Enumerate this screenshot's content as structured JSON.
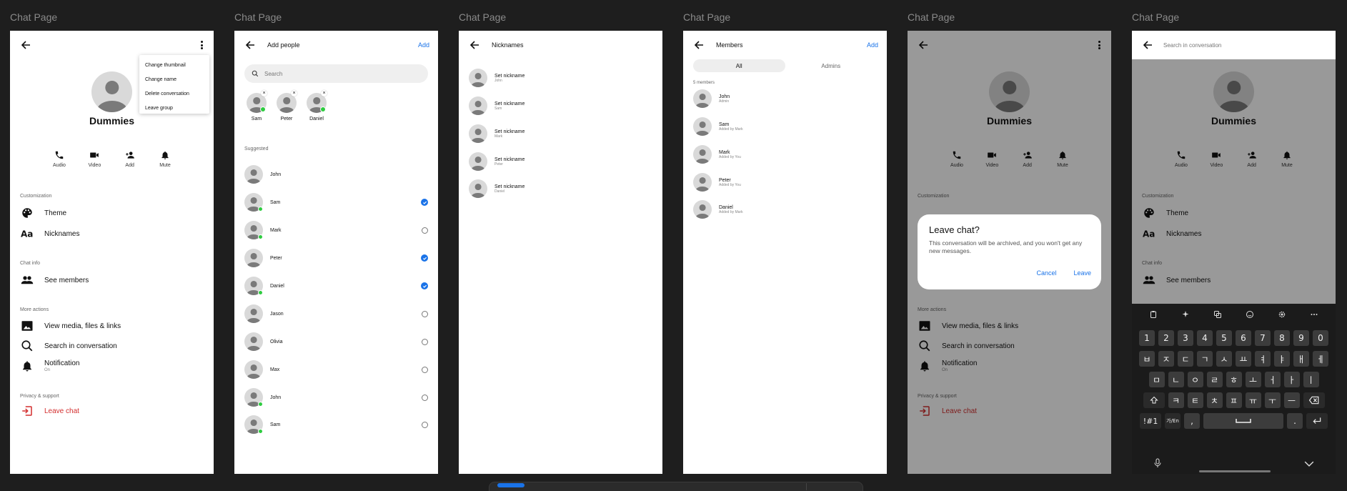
{
  "frames": [
    {
      "frame_title": "Chat Page",
      "group_name": "Dummies",
      "menu": [
        "Change thumbnail",
        "Change name",
        "Delete conversation",
        "Leave group"
      ],
      "actions": [
        "Audio",
        "Video",
        "Add",
        "Mute"
      ],
      "customization_label": "Customization",
      "theme": "Theme",
      "nicknames": "Nicknames",
      "chat_info_label": "Chat info",
      "see_members": "See members",
      "more_actions_label": "More actions",
      "view_media": "View media, files & links",
      "search_conversation": "Search in conversation",
      "notification": "Notification",
      "notification_sub": "On",
      "privacy_label": "Privacy & support",
      "leave_chat": "Leave chat"
    },
    {
      "frame_title": "Chat Page",
      "title": "Add people",
      "add": "Add",
      "search_placeholder": "Search",
      "selected": [
        {
          "name": "Sam",
          "online": true
        },
        {
          "name": "Peter",
          "online": false
        },
        {
          "name": "Daniel",
          "online": true
        }
      ],
      "x_symbol": "×",
      "suggested_label": "Suggested",
      "suggested": [
        {
          "name": "John",
          "online": false,
          "state": "none"
        },
        {
          "name": "Sam",
          "online": true,
          "state": "checked"
        },
        {
          "name": "Mark",
          "online": true,
          "state": "radio"
        },
        {
          "name": "Peter",
          "online": false,
          "state": "checked"
        },
        {
          "name": "Daniel",
          "online": true,
          "state": "checked"
        },
        {
          "name": "Jason",
          "online": false,
          "state": "radio"
        },
        {
          "name": "Olivia",
          "online": false,
          "state": "radio"
        },
        {
          "name": "Max",
          "online": false,
          "state": "radio"
        },
        {
          "name": "John",
          "online": true,
          "state": "radio"
        },
        {
          "name": "Sam",
          "online": true,
          "state": "radio"
        }
      ]
    },
    {
      "frame_title": "Chat Page",
      "title": "Nicknames",
      "items": [
        {
          "label": "Set nickname",
          "sub": "John"
        },
        {
          "label": "Set nickname",
          "sub": "Sam"
        },
        {
          "label": "Set nickname",
          "sub": "Mark"
        },
        {
          "label": "Set nickname",
          "sub": "Peter"
        },
        {
          "label": "Set nickname",
          "sub": "Daniel"
        }
      ]
    },
    {
      "frame_title": "Chat Page",
      "title": "Members",
      "add": "Add",
      "tabs": [
        "All",
        "Admins"
      ],
      "count_label": "5 members",
      "members": [
        {
          "name": "John",
          "sub": "Admin"
        },
        {
          "name": "Sam",
          "sub": "Added by Mark"
        },
        {
          "name": "Mark",
          "sub": "Added by You"
        },
        {
          "name": "Peter",
          "sub": "Added by You"
        },
        {
          "name": "Daniel",
          "sub": "Added by Mark"
        }
      ]
    },
    {
      "frame_title": "Chat Page",
      "group_name": "Dummies",
      "actions": [
        "Audio",
        "Video",
        "Add",
        "Mute"
      ],
      "customization_label": "Customization",
      "more_actions_label": "More actions",
      "view_media": "View media, files & links",
      "search_conversation": "Search in conversation",
      "notification": "Notification",
      "notification_sub": "On",
      "privacy_label": "Privacy & support",
      "leave_chat": "Leave chat",
      "dialog": {
        "title": "Leave chat?",
        "body": "This conversation will be archived, and you won't get any new messages.",
        "cancel": "Cancel",
        "leave": "Leave"
      }
    },
    {
      "frame_title": "Chat Page",
      "search_placeholder": "Search in conversation",
      "group_name": "Dummies",
      "actions": [
        "Audio",
        "Video",
        "Add",
        "Mute"
      ],
      "customization_label": "Customization",
      "theme": "Theme",
      "nicknames": "Nicknames",
      "chat_info_label": "Chat info",
      "see_members": "See members",
      "keyboard": {
        "row1": [
          "1",
          "2",
          "3",
          "4",
          "5",
          "6",
          "7",
          "8",
          "9",
          "0"
        ],
        "row2": [
          "ㅂ",
          "ㅈ",
          "ㄷ",
          "ㄱ",
          "ㅅ",
          "ㅛ",
          "ㅕ",
          "ㅑ",
          "ㅐ",
          "ㅔ"
        ],
        "row3": [
          "ㅁ",
          "ㄴ",
          "ㅇ",
          "ㄹ",
          "ㅎ",
          "ㅗ",
          "ㅓ",
          "ㅏ",
          "ㅣ"
        ],
        "row4": [
          "ㅋ",
          "ㅌ",
          "ㅊ",
          "ㅍ",
          "ㅠ",
          "ㅜ",
          "ㅡ"
        ],
        "symbols_key": "!#1",
        "lang_key": "가/En",
        "comma": ",",
        "period": "."
      }
    }
  ],
  "colors": {
    "accent": "#1a73e8",
    "danger": "#d32f2f",
    "online": "#2ecc40",
    "background": "#1e1e1e"
  }
}
